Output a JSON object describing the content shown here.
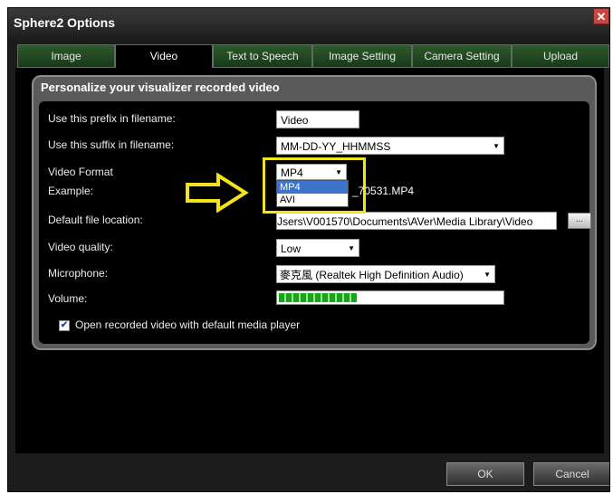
{
  "window": {
    "title": "Sphere2 Options",
    "close_glyph": "✕"
  },
  "tabs": [
    {
      "label": "Image"
    },
    {
      "label": "Video"
    },
    {
      "label": "Text to Speech"
    },
    {
      "label": "Image Setting"
    },
    {
      "label": "Camera Setting"
    },
    {
      "label": "Upload"
    }
  ],
  "active_tab": "Video",
  "panel": {
    "heading": "Personalize your visualizer recorded video",
    "prefix_label": "Use this prefix in filename:",
    "prefix_value": "Video",
    "suffix_label": "Use this suffix in filename:",
    "suffix_value": "MM-DD-YY_HHMMSS",
    "format_label": "Video Format",
    "format_value": "MP4",
    "format_options": [
      "MP4",
      "AVI"
    ],
    "example_label": "Example:",
    "example_value": "_70531.MP4",
    "location_label": "Default file location:",
    "location_value": "Jsers\\V001570\\Documents\\AVer\\Media Library\\Video",
    "browse_label": "...",
    "quality_label": "Video quality:",
    "quality_value": "Low",
    "mic_label": "Microphone:",
    "mic_value": "麥克風 (Realtek High Definition Audio)",
    "volume_label": "Volume:",
    "volume_level": 0.35,
    "open_label": "Open recorded video with default media player",
    "open_checked": true,
    "check_glyph": "✔"
  },
  "footer": {
    "ok_label": "OK",
    "cancel_label": "Cancel"
  },
  "colors": {
    "highlight": "#f2e31c",
    "tab_green": "#2e5a2c",
    "selection": "#3b74c9"
  }
}
